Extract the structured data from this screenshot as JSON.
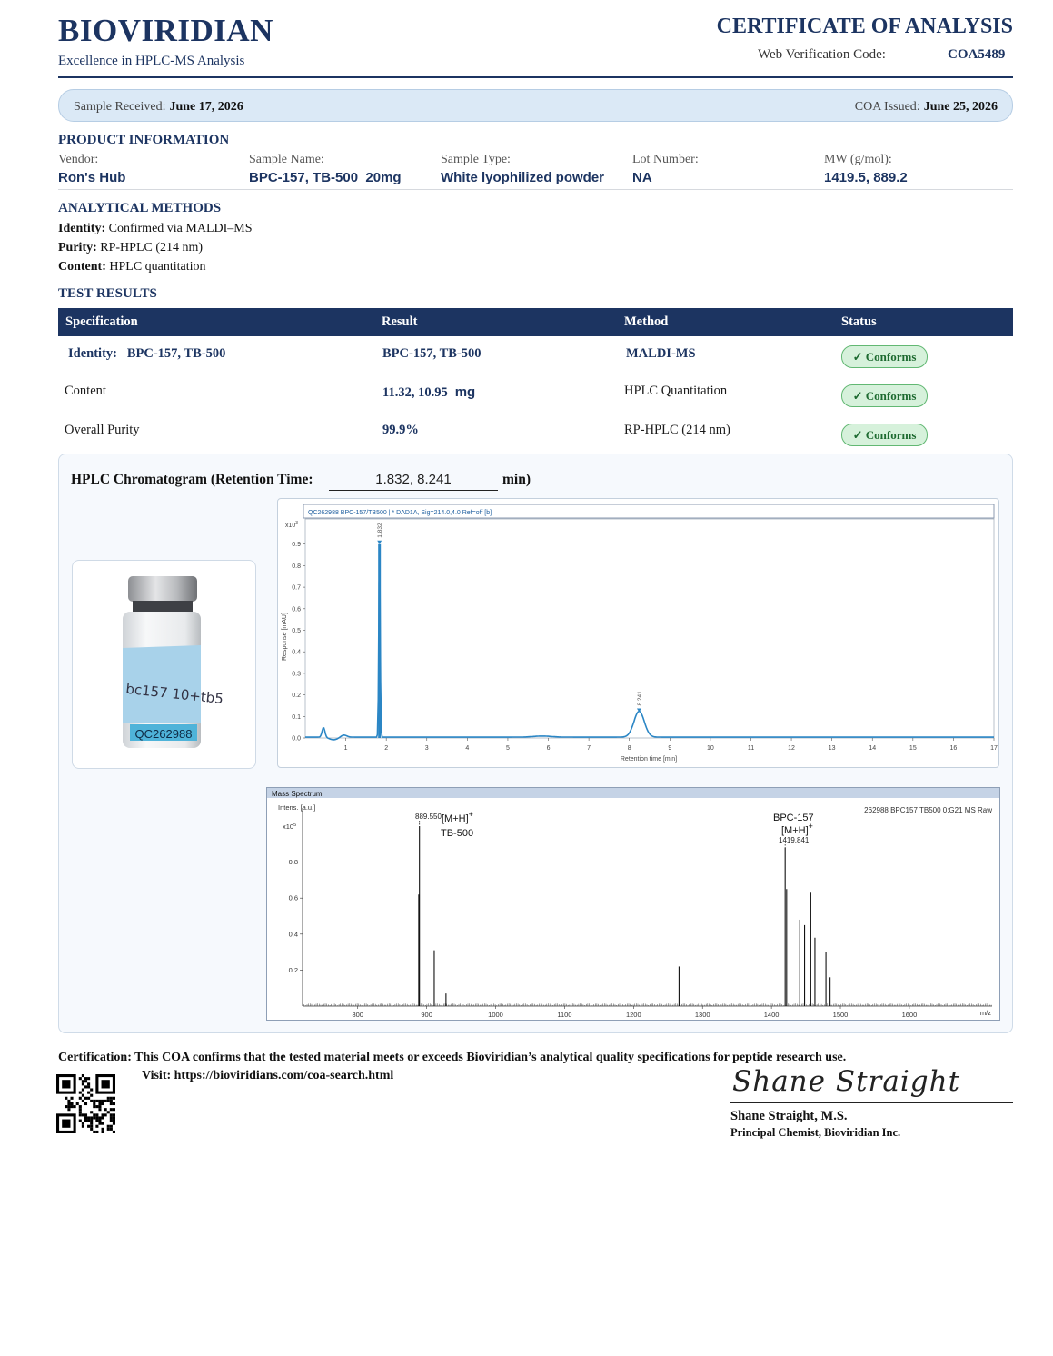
{
  "header": {
    "brand": "BIOVIRIDIAN",
    "tagline": "Excellence in HPLC-MS Analysis",
    "doc_title": "CERTIFICATE OF ANALYSIS",
    "verification_label": "Web Verification Code:",
    "verification_code": "COA5489"
  },
  "dates": {
    "received_label": "Sample Received:",
    "received_value": "June 17, 2026",
    "issued_label": "COA Issued:",
    "issued_value": "June 25, 2026"
  },
  "product": {
    "section_title": "PRODUCT INFORMATION",
    "fields": [
      {
        "label": "Vendor:",
        "value": "Ron's Hub"
      },
      {
        "label": "Sample Name:",
        "value": "BPC-157, TB-500  20mg"
      },
      {
        "label": "Sample Type:",
        "value": "White lyophilized powder"
      },
      {
        "label": "Lot Number:",
        "value": "NA"
      },
      {
        "label": "MW (g/mol):",
        "value": "1419.5, 889.2"
      }
    ]
  },
  "methods": {
    "section_title": "ANALYTICAL METHODS",
    "items": [
      {
        "label": "Identity:",
        "value": "Confirmed via MALDI–MS"
      },
      {
        "label": "Purity:",
        "value": "RP-HPLC (214 nm)"
      },
      {
        "label": "Content:",
        "value": "HPLC quantitation"
      }
    ]
  },
  "results": {
    "section_title": "TEST RESULTS",
    "columns": [
      "Specification",
      "Result",
      "Method",
      "Status"
    ],
    "rows": [
      {
        "spec": "Identity:   BPC-157, TB-500",
        "result": "BPC-157, TB-500",
        "method": "MALDI-MS",
        "status": "✓ Conforms"
      },
      {
        "spec": "Content",
        "result": "11.32, 10.95",
        "result_unit": "mg",
        "method": "HPLC Quantitation",
        "status": "✓ Conforms"
      },
      {
        "spec": "Overall Purity",
        "result": "99.9%",
        "method": "RP-HPLC (214 nm)",
        "status": "✓ Conforms"
      }
    ]
  },
  "chromatogram": {
    "title": "HPLC Chromatogram (Retention Time:",
    "retention_times": "1.832, 8.241",
    "unit": "min)"
  },
  "vial": {
    "label_text": "bc157 10+tb5",
    "code": "QC262988"
  },
  "chart_data": [
    {
      "type": "line",
      "header": "QC262988 BPC-157/TB500 | * DAD1A, Sig=214.0,4.0 Ref=off [b]",
      "ylabel": "Response [mAU]",
      "y_multiplier": "x10",
      "y_multiplier_exp": "3",
      "xlabel": "Retention time [min]",
      "xlim": [
        0,
        17
      ],
      "ylim": [
        0,
        1.0
      ],
      "x_ticks": [
        1,
        2,
        3,
        4,
        5,
        6,
        7,
        8,
        9,
        10,
        11,
        12,
        13,
        14,
        15,
        16,
        17
      ],
      "y_ticks": [
        "0.0",
        "0.1",
        "0.2",
        "0.3",
        "0.4",
        "0.5",
        "0.6",
        "0.7",
        "0.8",
        "0.9"
      ],
      "peaks": [
        {
          "x": 1.832,
          "y": 0.9,
          "label": "1.832"
        },
        {
          "x": 8.241,
          "y": 0.12,
          "label": "8.241"
        }
      ]
    },
    {
      "type": "line",
      "header": "Mass Spectrum",
      "run_label": "262988 BPC157 TB500 0:G21 MS Raw",
      "ylabel": "Intens. [a.u.]",
      "y_multiplier": "x10",
      "y_multiplier_exp": "5",
      "xlabel": "m/z",
      "xlim": [
        720,
        1720
      ],
      "ylim": [
        0,
        1.0
      ],
      "x_ticks": [
        800,
        900,
        1000,
        1100,
        1200,
        1300,
        1400,
        1500,
        1600
      ],
      "y_ticks": [
        "0.2",
        "0.4",
        "0.6",
        "0.8"
      ],
      "peaks": [
        {
          "x": 889.55,
          "y": 1.0
        },
        {
          "x": 888.5,
          "y": 0.62
        },
        {
          "x": 911,
          "y": 0.31
        },
        {
          "x": 928,
          "y": 0.07
        },
        {
          "x": 1266,
          "y": 0.22
        },
        {
          "x": 1419.841,
          "y": 0.88
        },
        {
          "x": 1422,
          "y": 0.65
        },
        {
          "x": 1441,
          "y": 0.48
        },
        {
          "x": 1448,
          "y": 0.45
        },
        {
          "x": 1457,
          "y": 0.63
        },
        {
          "x": 1463,
          "y": 0.38
        },
        {
          "x": 1479,
          "y": 0.3
        },
        {
          "x": 1485,
          "y": 0.16
        }
      ],
      "annotations": [
        {
          "mz_label": "889.550",
          "ion": "[M+H]",
          "sup": "+",
          "name": "TB-500"
        },
        {
          "mz_label": "1419.841",
          "ion": "[M+H]",
          "sup": "+",
          "name": "BPC-157"
        }
      ]
    }
  ],
  "footer": {
    "certification_label": "Certification:",
    "certification_text": "This COA confirms that the tested material meets or exceeds Bioviridian’s analytical quality specifications for peptide research use.",
    "visit": "Visit: https://bioviridians.com/coa-search.html",
    "signature_script": "Shane Straight",
    "signer_name": "Shane Straight, M.S.",
    "signer_title": "Principal Chemist, Bioviridian Inc."
  },
  "colors": {
    "navy": "#1c3461",
    "trace_blue": "#2b86c5",
    "conform_green": "#1d6a30",
    "badge_fill": "#d6f1db"
  }
}
